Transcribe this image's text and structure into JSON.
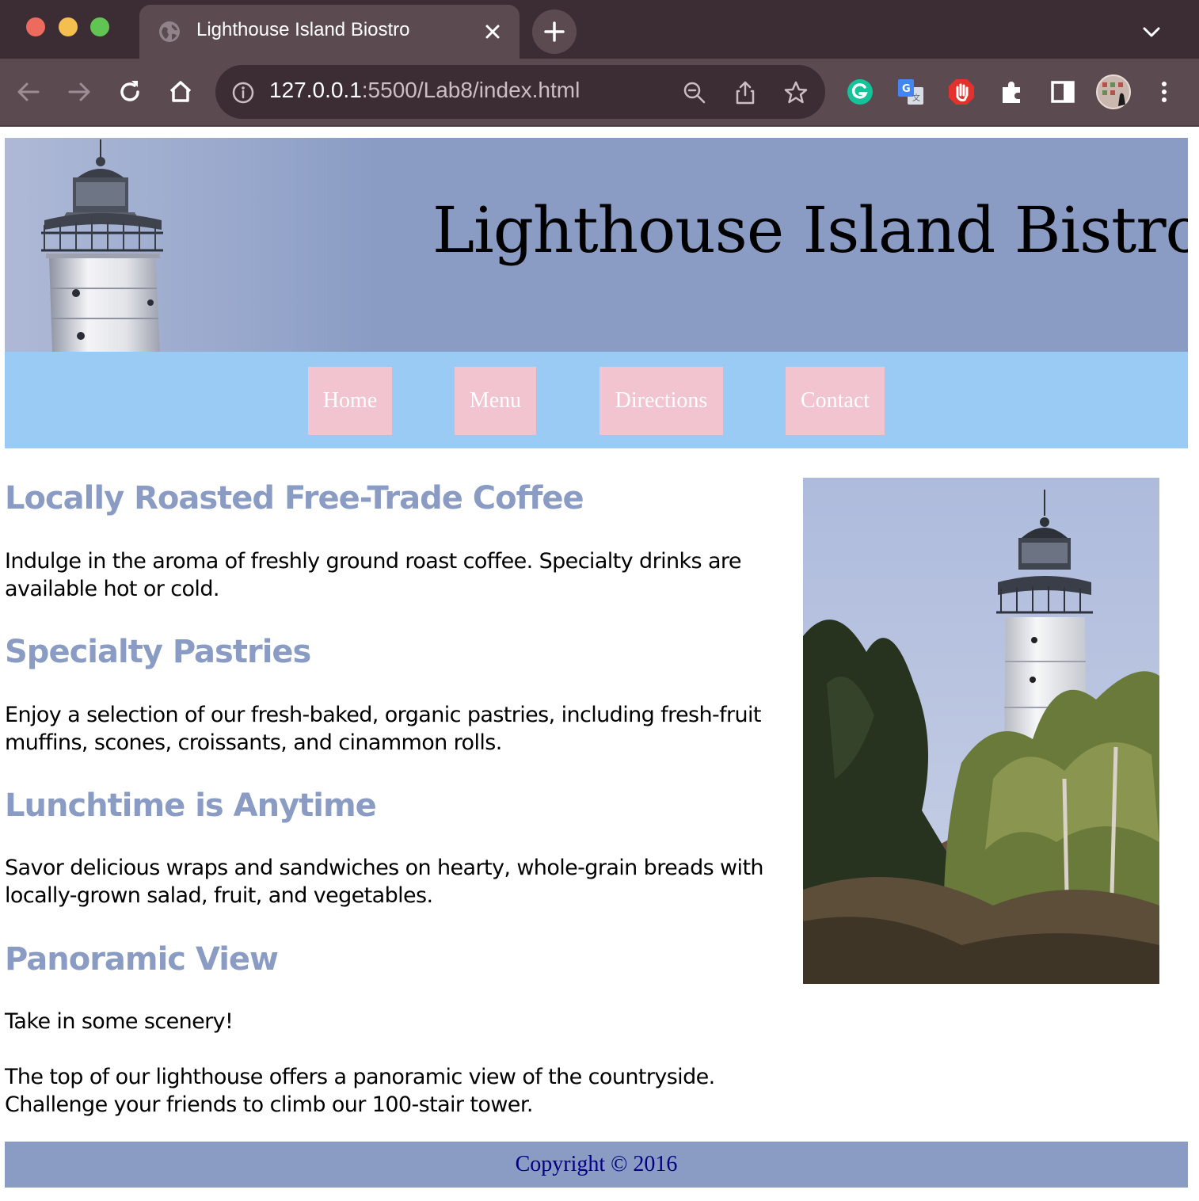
{
  "browser": {
    "tab_title": "Lighthouse Island Biostro",
    "url_host": "127.0.0.1",
    "url_rest": ":5500/Lab8/index.html"
  },
  "site": {
    "title": "Lighthouse Island Bistro",
    "nav": [
      "Home",
      "Menu",
      "Directions",
      "Contact"
    ],
    "sections": [
      {
        "heading": "Locally Roasted Free-Trade Coffee",
        "paragraphs": [
          "Indulge in the aroma of freshly ground roast coffee. Specialty drinks are available hot or cold."
        ]
      },
      {
        "heading": "Specialty Pastries",
        "paragraphs": [
          "Enjoy a selection of our fresh-baked, organic pastries, including fresh-fruit muffins, scones, croissants, and cinammon rolls."
        ]
      },
      {
        "heading": "Lunchtime is Anytime",
        "paragraphs": [
          "Savor delicious wraps and sandwiches on hearty, whole-grain breads with locally-grown salad, fruit, and vegetables."
        ]
      },
      {
        "heading": "Panoramic View",
        "paragraphs": [
          "Take in some scenery!",
          "The top of our lighthouse offers a panoramic view of the countryside. Challenge your friends to climb our 100-stair tower."
        ]
      }
    ],
    "footer": "Copyright © 2016"
  },
  "colors": {
    "header_bg": "#8a9cc4",
    "nav_bg": "#99cbf5",
    "nav_button_bg": "#f2c4cf",
    "heading": "#8a9cc4",
    "footer_text": "#000080",
    "chrome_dark": "#3b2d33",
    "chrome_mid": "#5c4a51"
  }
}
